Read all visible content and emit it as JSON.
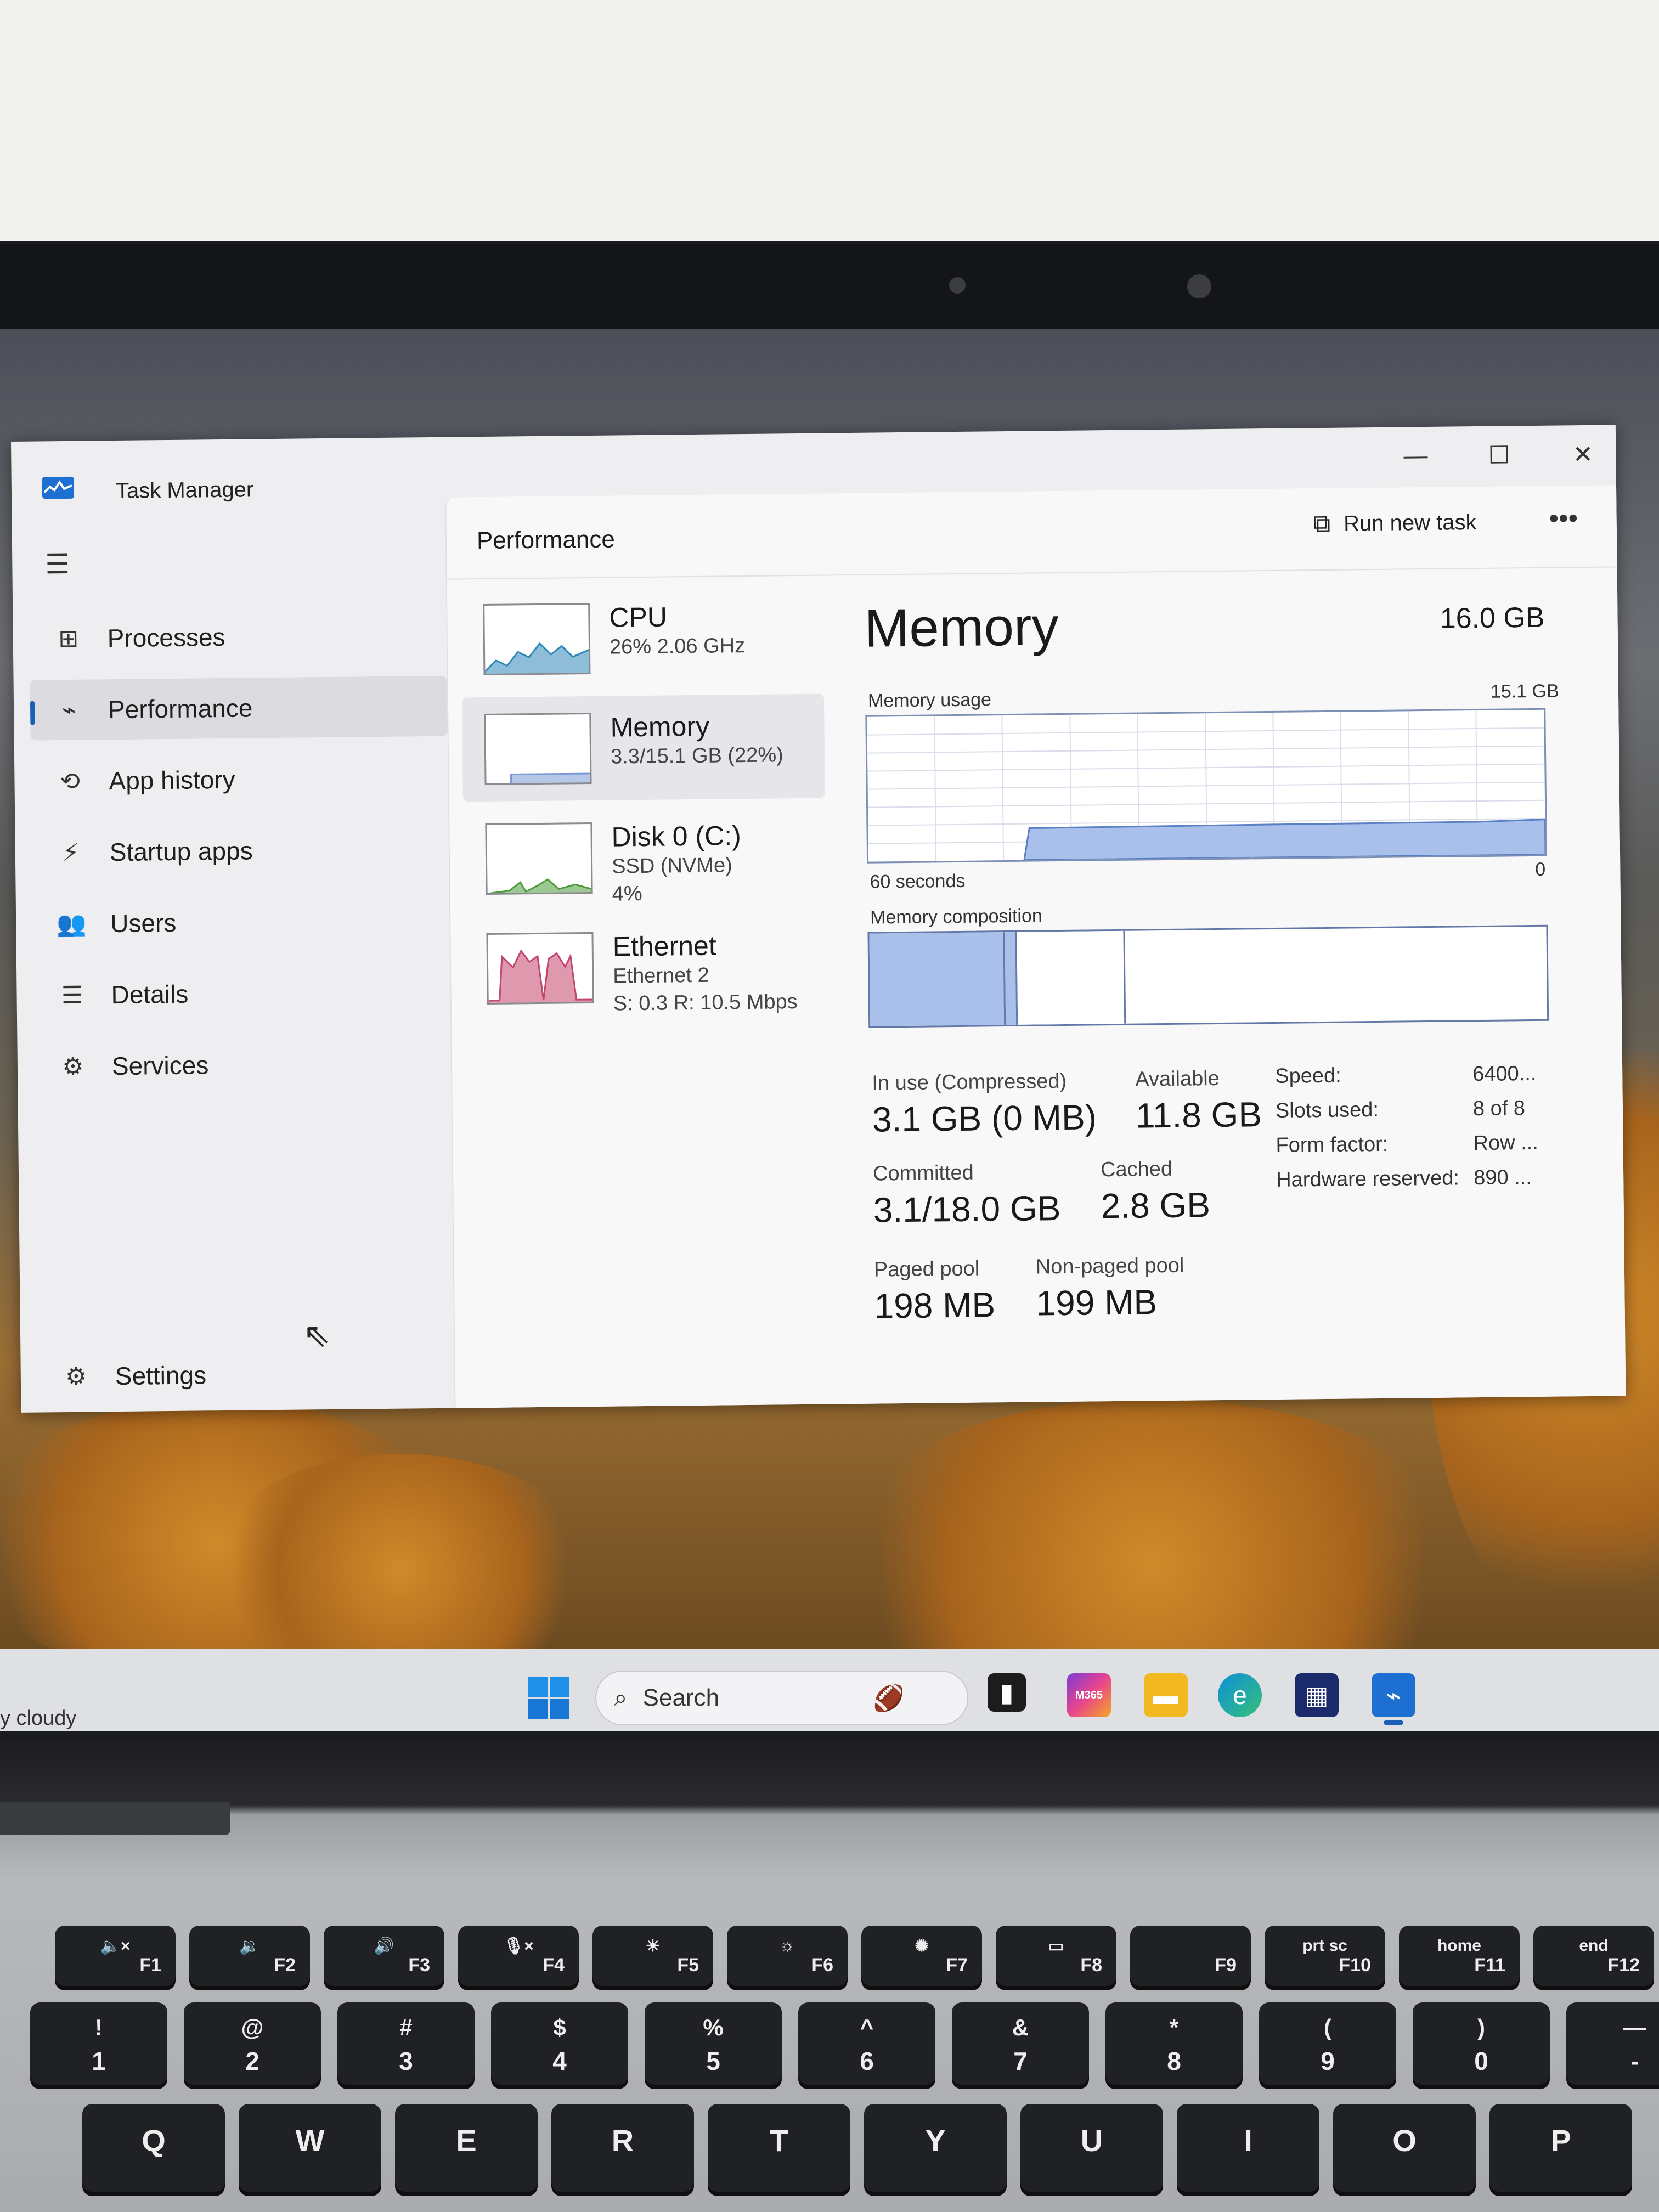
{
  "window": {
    "title": "Task Manager",
    "controls": {
      "minimize": "—",
      "maximize": "☐",
      "close": "✕"
    }
  },
  "sidebar": {
    "items": [
      {
        "label": "Processes",
        "icon": "processes-icon",
        "glyph": "⊞"
      },
      {
        "label": "Performance",
        "icon": "performance-icon",
        "glyph": "⌁",
        "selected": true
      },
      {
        "label": "App history",
        "icon": "app-history-icon",
        "glyph": "⟲"
      },
      {
        "label": "Startup apps",
        "icon": "startup-apps-icon",
        "glyph": "⚡"
      },
      {
        "label": "Users",
        "icon": "users-icon",
        "glyph": "👥"
      },
      {
        "label": "Details",
        "icon": "details-icon",
        "glyph": "☰"
      },
      {
        "label": "Services",
        "icon": "services-icon",
        "glyph": "⚙"
      }
    ],
    "settings": {
      "label": "Settings",
      "icon": "settings-icon",
      "glyph": "⚙"
    }
  },
  "header": {
    "title": "Performance",
    "run_new_task": "Run new task",
    "more": "•••"
  },
  "devices": [
    {
      "name": "CPU",
      "line1": "26%  2.06 GHz",
      "line2": "",
      "color": "#2f87b8",
      "selected": false
    },
    {
      "name": "Memory",
      "line1": "3.3/15.1 GB (22%)",
      "line2": "",
      "color": "#7a9bd6",
      "selected": true
    },
    {
      "name": "Disk 0 (C:)",
      "line1": "SSD (NVMe)",
      "line2": "4%",
      "color": "#4c9a3a",
      "selected": false
    },
    {
      "name": "Ethernet",
      "line1": "Ethernet 2",
      "line2": "S: 0.3  R: 10.5 Mbps",
      "color": "#c2456b",
      "selected": false
    }
  ],
  "memory": {
    "title": "Memory",
    "total": "16.0 GB",
    "usage_label": "Memory usage",
    "usage_max": "15.1 GB",
    "time_left": "60 seconds",
    "time_right": "0",
    "usage_fraction": 0.22,
    "composition_label": "Memory composition",
    "composition": {
      "in_use": 0.2,
      "modified": 0.018,
      "standby": 0.16
    },
    "stats": {
      "in_use_label": "In use (Compressed)",
      "in_use_value": "3.1 GB (0 MB)",
      "available_label": "Available",
      "available_value": "11.8 GB",
      "committed_label": "Committed",
      "committed_value": "3.1/18.0 GB",
      "cached_label": "Cached",
      "cached_value": "2.8 GB",
      "paged_label": "Paged pool",
      "paged_value": "198 MB",
      "nonpaged_label": "Non-paged pool",
      "nonpaged_value": "199 MB"
    },
    "hw": [
      {
        "key": "Speed:",
        "value": "6400..."
      },
      {
        "key": "Slots used:",
        "value": "8 of 8"
      },
      {
        "key": "Form factor:",
        "value": "Row ..."
      },
      {
        "key": "Hardware reserved:",
        "value": "890 ..."
      }
    ]
  },
  "taskbar": {
    "weather": "y cloudy",
    "search_placeholder": "Search",
    "icons": [
      "widgets-icon",
      "terminal-icon",
      "m365-icon",
      "file-explorer-icon",
      "edge-icon",
      "store-icon",
      "task-manager-icon"
    ],
    "m365_label": "M365"
  },
  "keyboard": {
    "frow": [
      {
        "glyph": "🔈×",
        "f": "F1"
      },
      {
        "glyph": "🔉",
        "f": "F2"
      },
      {
        "glyph": "🔊",
        "f": "F3"
      },
      {
        "glyph": "🎙×",
        "f": "F4"
      },
      {
        "glyph": "☀",
        "f": "F5"
      },
      {
        "glyph": "☼",
        "f": "F6"
      },
      {
        "glyph": "✺",
        "f": "F7"
      },
      {
        "glyph": "▭",
        "f": "F8"
      },
      {
        "glyph": "",
        "f": "F9"
      },
      {
        "glyph": "prt sc",
        "f": "F10"
      },
      {
        "glyph": "home",
        "f": "F11"
      },
      {
        "glyph": "end",
        "f": "F12"
      }
    ],
    "numrow": [
      {
        "top": "!",
        "bottom": "1"
      },
      {
        "top": "@",
        "bottom": "2"
      },
      {
        "top": "#",
        "bottom": "3"
      },
      {
        "top": "$",
        "bottom": "4"
      },
      {
        "top": "%",
        "bottom": "5"
      },
      {
        "top": "^",
        "bottom": "6"
      },
      {
        "top": "&",
        "bottom": "7"
      },
      {
        "top": "*",
        "bottom": "8"
      },
      {
        "top": "(",
        "bottom": "9"
      },
      {
        "top": ")",
        "bottom": "0"
      },
      {
        "top": "—",
        "bottom": "-"
      }
    ],
    "qrow": [
      "Q",
      "W",
      "E",
      "R",
      "T",
      "Y",
      "U",
      "I",
      "O",
      "P"
    ]
  }
}
